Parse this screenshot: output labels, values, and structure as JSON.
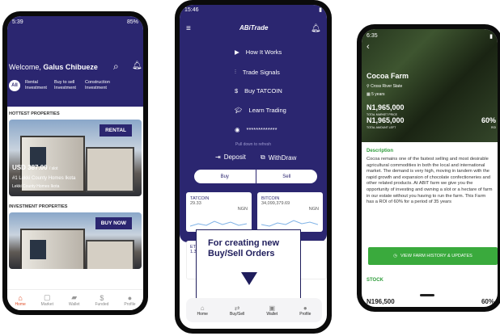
{
  "screen1": {
    "status_time": "5:39",
    "status_right": "85%",
    "welcome_prefix": "Welcome, ",
    "user_name": "Galus Chibueze",
    "tabs": [
      {
        "label": "All"
      },
      {
        "label": "Rental Investment"
      },
      {
        "label": "Buy to sell Investment"
      },
      {
        "label": "Construction Investment"
      }
    ],
    "hottest_title": "HOTTEST PROPERTIES",
    "card1": {
      "tag": "RENTAL",
      "price": "USD 387.00",
      "price_unit": "/ slot",
      "name": "#1 Lekki County Homes Ikota",
      "location": "Lekki County Homes Ikota"
    },
    "investment_title": "INVESTMENT PROPERTIES",
    "card2": {
      "tag": "BUY NOW"
    },
    "nav": [
      {
        "label": "Home",
        "icon": "home-icon"
      },
      {
        "label": "Market",
        "icon": "market-icon"
      },
      {
        "label": "Wallet",
        "icon": "wallet-icon"
      },
      {
        "label": "Funded",
        "icon": "funded-icon"
      },
      {
        "label": "Profile",
        "icon": "profile-icon"
      }
    ],
    "accent": "#2b2670",
    "active_color": "#e0502a"
  },
  "screen2": {
    "status_time": "15:46",
    "logo": "ABiTrade",
    "menu": [
      {
        "label": "How It Works",
        "icon": "play-icon"
      },
      {
        "label": "Trade Signals",
        "icon": "signal-icon"
      },
      {
        "label": "Buy TATCOIN",
        "icon": "dollar-icon"
      },
      {
        "label": "Learn Trading",
        "icon": "graduation-cap-icon"
      }
    ],
    "masked": "*************",
    "pull": "Pull down to refresh",
    "deposit": "Deposit",
    "withdraw": "WithDraw",
    "buy": "Buy",
    "sell": "Sell",
    "tickers": [
      {
        "name": "TATCOIN",
        "value": "29.33",
        "unit": "NGN"
      },
      {
        "name": "BITCOIN",
        "value": "34,099,379.69",
        "unit": "NGN"
      }
    ],
    "eth": {
      "name": "ETH",
      "value": "1.3"
    },
    "callout": "For creating new Buy/Sell Orders",
    "nav": [
      {
        "label": "Home",
        "icon": "home-icon"
      },
      {
        "label": "Buy/Sell",
        "icon": "chart-icon"
      },
      {
        "label": "Wallet",
        "icon": "wallet-icon"
      },
      {
        "label": "Profile",
        "icon": "profile-icon"
      }
    ]
  },
  "screen3": {
    "status_time": "6:35",
    "title": "Cocoa Farm",
    "location": "Cross River State",
    "duration": "5 years",
    "market_price": "N1,965,000",
    "market_label": "TOTAL MARKET PRICE",
    "amount": "N1,965,000",
    "amount_label": "TOTAL AMOUNT LEFT",
    "roi": "60%",
    "roi_label": "ROI",
    "desc_title": "Description",
    "description": "Cocoa remains one of the fastest selling and most desirable agricultural commodities in both the local and international market. The demand is very high, moving in tandem with the rapid growth and expansion of chocolate confectioneries and other related products. At ABIT farm we give you the opportunity of investing and owning a slot or a hectare of farm in our estate without you having to run the farm. This Farm has a ROI of 60% for a period of 35 years",
    "history_button": "VIEW FARM HISTORY & UPDATES",
    "stock_title": "STOCK",
    "bottom_price": "N196,500",
    "bottom_pct": "60%"
  }
}
